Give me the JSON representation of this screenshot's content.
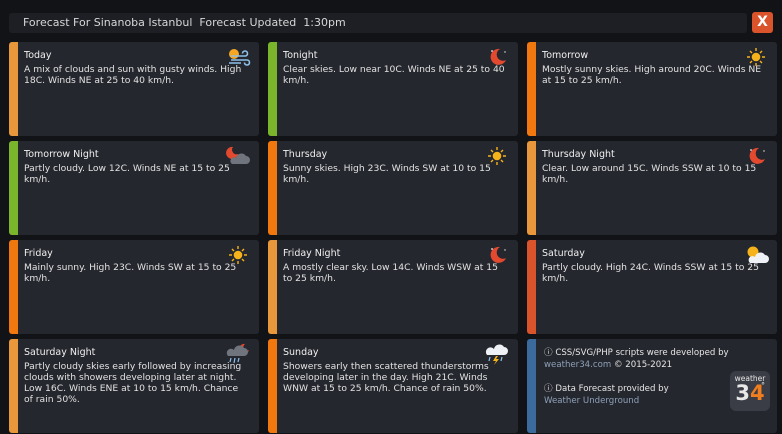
{
  "header": {
    "title": "Forecast For Sinanoba Istanbul  Forecast Updated  1:30pm",
    "close_label": "X"
  },
  "colors": {
    "orange": "#f0780f",
    "amber": "#e8973a",
    "green": "#7ab52c",
    "red_orange": "#d9532b",
    "blue": "#3b6a9c"
  },
  "periods": [
    {
      "name": "Today",
      "text": "A mix of clouds and sun with gusty winds. High 18C. Winds NE at 25 to 40 km/h.",
      "icon": "wind-sun-icon",
      "accent": "#e8973a"
    },
    {
      "name": "Tonight",
      "text": "Clear skies. Low near 10C. Winds NE at 25 to 40 km/h.",
      "icon": "moon-clear-icon",
      "accent": "#7ab52c"
    },
    {
      "name": "Tomorrow",
      "text": "Mostly sunny skies. High around 20C. Winds NE at 15 to 25 km/h.",
      "icon": "sun-icon",
      "accent": "#f0780f"
    },
    {
      "name": "Tomorrow Night",
      "text": "Partly cloudy. Low 12C. Winds NE at 15 to 25 km/h.",
      "icon": "cloudy-night-icon",
      "accent": "#7ab52c"
    },
    {
      "name": "Thursday",
      "text": "Sunny skies. High 23C. Winds SW at 10 to 15 km/h.",
      "icon": "sun-icon",
      "accent": "#f0780f"
    },
    {
      "name": "Thursday Night",
      "text": "Clear. Low around 15C. Winds SSW at 10 to 15 km/h.",
      "icon": "moon-clear-icon",
      "accent": "#e8973a"
    },
    {
      "name": "Friday",
      "text": "Mainly sunny. High 23C. Winds SW at 15 to 25 km/h.",
      "icon": "sun-icon",
      "accent": "#f0780f"
    },
    {
      "name": "Friday Night",
      "text": "A mostly clear sky. Low 14C. Winds WSW at 15 to 25 km/h.",
      "icon": "moon-clear-icon",
      "accent": "#e8973a"
    },
    {
      "name": "Saturday",
      "text": "Partly cloudy. High 24C. Winds SSW at 15 to 25 km/h.",
      "icon": "partly-cloudy-icon",
      "accent": "#d9532b"
    },
    {
      "name": "Saturday Night",
      "text": "Partly cloudy skies early followed by increasing clouds with showers developing later at night. Low 16C. Winds ENE at 10 to 15 km/h. Chance of rain 50%.",
      "icon": "rain-night-icon",
      "accent": "#e8973a"
    },
    {
      "name": "Sunday",
      "text": "Showers early then scattered thunderstorms developing later in the day. High 21C. Winds WNW at 15 to 25 km/h. Chance of rain 50%.",
      "icon": "thunderstorm-icon",
      "accent": "#f0780f"
    }
  ],
  "credits": {
    "line1": "ⓘ CSS/SVG/PHP scripts were developed by",
    "site": "weather34.com",
    "years": " © 2015-2021",
    "line3": "ⓘ Data Forecast provided by",
    "provider": "Weather Underground",
    "logo_word": "weather",
    "logo_num_a": "3",
    "logo_num_b": "4",
    "logo_deg": "°",
    "accent": "#3b6a9c"
  }
}
